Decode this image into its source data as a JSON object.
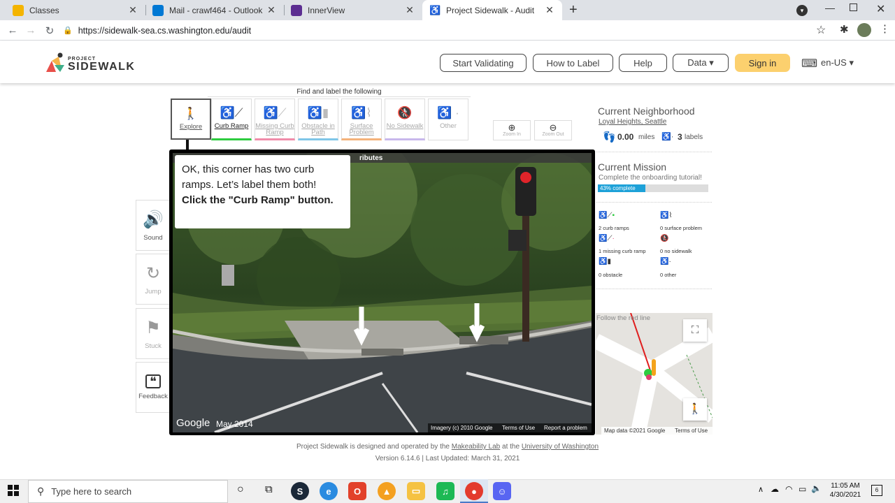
{
  "browser": {
    "tabs": [
      {
        "title": "Classes",
        "color": "#f4b400"
      },
      {
        "title": "Mail - crawf464 - Outlook",
        "color": "#0078d4"
      },
      {
        "title": "InnerView",
        "color": "#5c2d91"
      },
      {
        "title": "Project Sidewalk - Audit",
        "color": "#ffffff"
      }
    ],
    "url": "https://sidewalk-sea.cs.washington.edu/audit"
  },
  "site": {
    "logo_top": "PROJECT",
    "logo_main": "SIDEWALK",
    "nav": [
      "Start Validating",
      "How to Label",
      "Help",
      "Data ▾"
    ],
    "signin": "Sign in",
    "lang": "en-US ▾"
  },
  "toolbar": {
    "heading": "Find and label the following",
    "explore": "Explore",
    "tools": [
      {
        "label": "Curb Ramp",
        "color": "#2ecc40"
      },
      {
        "label": "Missing Curb Ramp",
        "color": "#f08caa"
      },
      {
        "label": "Obstacle in Path",
        "color": "#7fc6e8"
      },
      {
        "label": "Surface Problem",
        "color": "#f4b27a"
      },
      {
        "label": "No Sidewalk",
        "color": "#c8b8ec"
      },
      {
        "label": "Other",
        "color": "#dddddd"
      }
    ],
    "zoom_in": "Zoom In",
    "zoom_out": "Zoom Out"
  },
  "side_tools": [
    "Sound",
    "Jump",
    "Stuck",
    "Feedback"
  ],
  "panorama": {
    "strip": "ributes",
    "tutorial_line1": "OK, this corner has two curb ramps. Let’s label them both!",
    "tutorial_bold": "Click the \"Curb Ramp\" button.",
    "google": "Google",
    "date": "May 2014",
    "imagery": "Imagery (c) 2010 Google",
    "terms": "Terms of Use",
    "report": "Report a problem"
  },
  "right": {
    "neigh_title": "Current Neighborhood",
    "neigh_name": "Loyal Heights, Seattle",
    "miles": "0.00",
    "miles_unit": "miles",
    "labels": "3",
    "labels_unit": "labels",
    "mission_title": "Current Mission",
    "mission_text": "Complete the onboarding tutorial!",
    "progress_text": "43% complete",
    "progress": 0.43,
    "counts": [
      "2 curb ramps",
      "0 surface problem",
      "1 missing curb ramp",
      "0 no sidewalk",
      "0 obstacle",
      "0 other"
    ],
    "map_hint": "Follow the red line",
    "map_data": "Map data ©2021 Google",
    "map_terms": "Terms of Use"
  },
  "footer": {
    "line1_a": "Project Sidewalk is designed and operated by the",
    "line1_link1": "Makeability Lab",
    "line1_b": "at the",
    "line1_link2": "University of Washington",
    "line2": "Version 6.14.6 | Last Updated: March 31, 2021"
  },
  "taskbar": {
    "search": "Type here to search",
    "time": "11:05 AM",
    "date": "4/30/2021",
    "notif": "6"
  }
}
